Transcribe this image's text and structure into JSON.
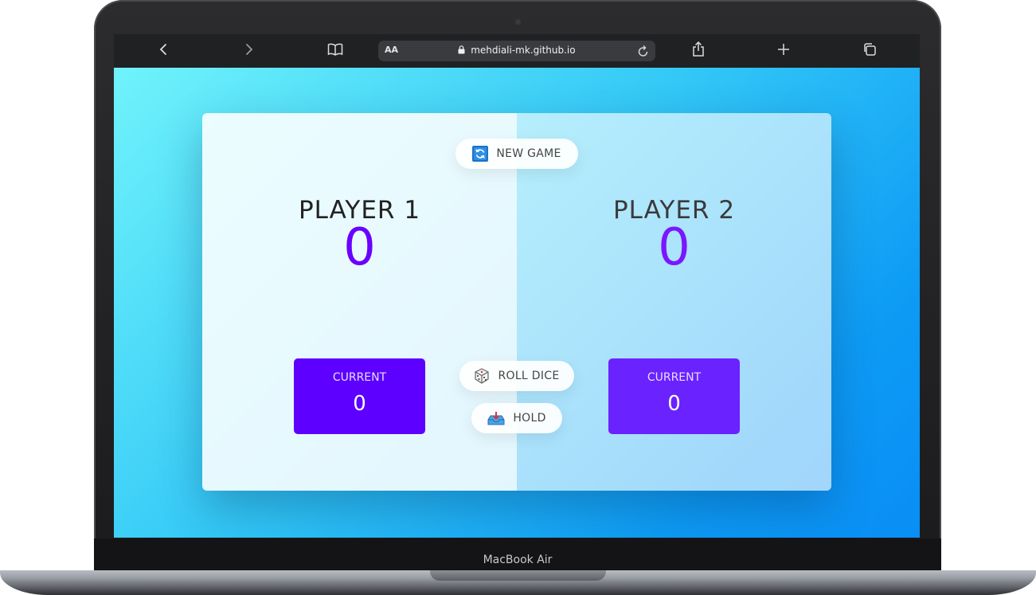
{
  "browser": {
    "url": "mehdiali-mk.github.io",
    "text_size_label": "AA",
    "icons": [
      "back-icon",
      "forward-icon",
      "bookmarks-icon",
      "lock-icon",
      "reload-icon",
      "share-icon",
      "new-tab-icon",
      "tabs-icon"
    ]
  },
  "game": {
    "new_game_label": "NEW GAME",
    "roll_dice_label": "ROLL DICE",
    "hold_label": "HOLD",
    "players": [
      {
        "name": "PLAYER 1",
        "score": "0",
        "current_label": "CURRENT",
        "current_score": "0"
      },
      {
        "name": "PLAYER 2",
        "score": "0",
        "current_label": "CURRENT",
        "current_score": "0"
      }
    ]
  },
  "device": {
    "model": "MacBook Air"
  },
  "colors": {
    "accent": "#5d00ff",
    "score": "#6a00ff",
    "toolbar": "#202123"
  }
}
